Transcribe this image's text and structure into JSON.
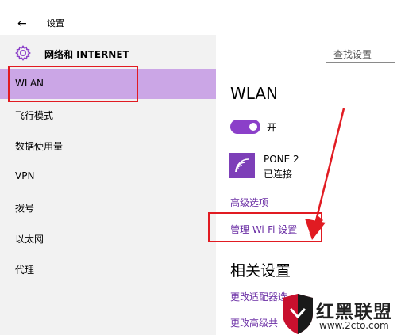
{
  "window": {
    "back_glyph": "←",
    "title": "设置"
  },
  "category": {
    "icon": "gear-icon",
    "title": "网络和 INTERNET"
  },
  "search": {
    "placeholder": "查找设置"
  },
  "sidebar": {
    "items": [
      {
        "label": "WLAN",
        "selected": true
      },
      {
        "label": "飞行模式"
      },
      {
        "label": "数据使用量"
      },
      {
        "label": "VPN"
      },
      {
        "label": "拨号"
      },
      {
        "label": "以太网"
      },
      {
        "label": "代理"
      }
    ]
  },
  "main": {
    "title": "WLAN",
    "toggle": {
      "state_label": "开",
      "on": true
    },
    "network": {
      "icon": "wifi-icon",
      "name": "PONE 2",
      "status": "已连接"
    },
    "links": {
      "advanced": "高级选项",
      "manage": "管理 Wi-Fi 设置"
    },
    "related": {
      "title": "相关设置",
      "link1": "更改适配器选",
      "link2": "更改高级共"
    }
  },
  "watermark": {
    "brand": "红黑联盟",
    "url": "www.2cto.com"
  },
  "colors": {
    "accent": "#8b3fc9",
    "selected_bg": "#cba6e6",
    "highlight": "#e11b22",
    "link": "#6b2fa5"
  }
}
